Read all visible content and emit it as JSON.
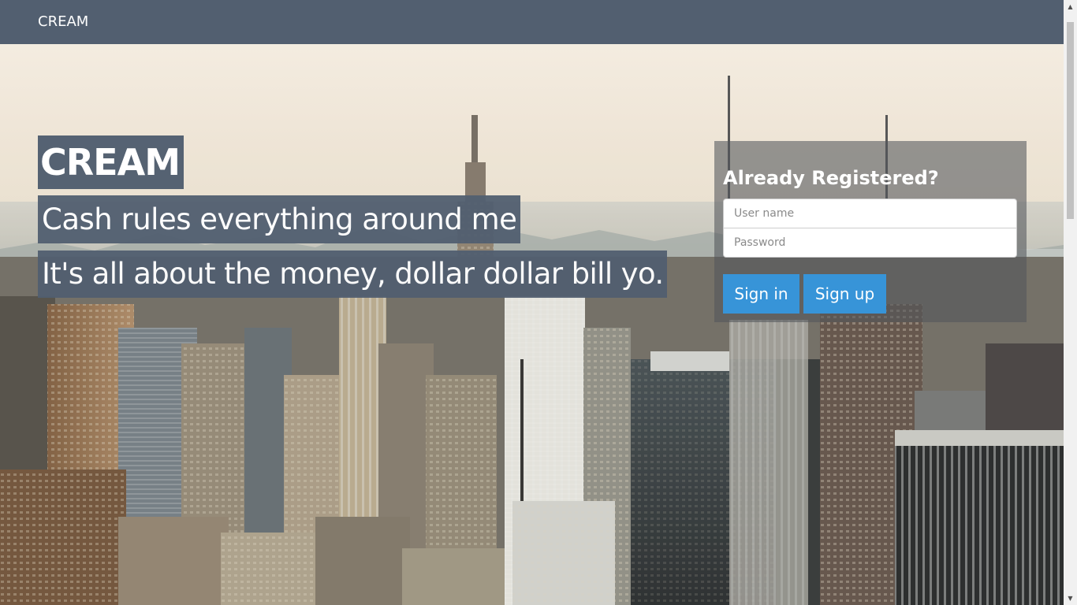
{
  "navbar": {
    "brand": "CREAM"
  },
  "hero": {
    "title": "CREAM",
    "tagline": "Cash rules everything around me",
    "subtagline": "It's all about the money, dollar dollar bill yo."
  },
  "login": {
    "heading": "Already Registered?",
    "username_placeholder": "User name",
    "username_value": "",
    "password_placeholder": "Password",
    "password_value": "",
    "signin_label": "Sign in",
    "signup_label": "Sign up"
  },
  "scrollbar": {
    "up_icon": "▲",
    "down_icon": "▼"
  },
  "colors": {
    "navbar": "#525f70",
    "headline_bg": "#525f70",
    "button": "#3794d8",
    "panel": "rgba(82,86,92,0.58)"
  }
}
